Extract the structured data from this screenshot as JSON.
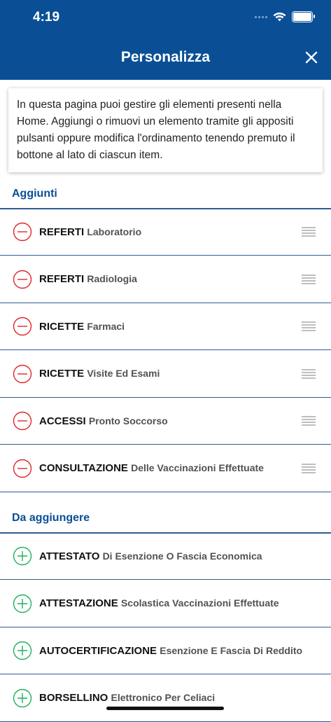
{
  "status_bar": {
    "time": "4:19"
  },
  "header": {
    "title": "Personalizza"
  },
  "info_text": "In questa pagina puoi gestire gli elementi presenti nella Home. Aggiungi o rimuovi un elemento tramite gli appositi pulsanti oppure modifica l'ordinamento tenendo premuto il bottone al lato di ciascun item.",
  "added": {
    "title": "Aggiunti",
    "items": [
      {
        "bold": "REFERTI",
        "rest": "Laboratorio"
      },
      {
        "bold": "REFERTI",
        "rest": "Radiologia"
      },
      {
        "bold": "RICETTE",
        "rest": "Farmaci"
      },
      {
        "bold": "RICETTE",
        "rest": "Visite Ed Esami"
      },
      {
        "bold": "ACCESSI",
        "rest": "Pronto Soccorso"
      },
      {
        "bold": "CONSULTAZIONE",
        "rest": "Delle Vaccinazioni Effettuate"
      }
    ]
  },
  "to_add": {
    "title": "Da aggiungere",
    "items": [
      {
        "bold": "ATTESTATO",
        "rest": "Di Esenzione O Fascia Economica"
      },
      {
        "bold": "ATTESTAZIONE",
        "rest": "Scolastica Vaccinazioni Effettuate"
      },
      {
        "bold": "AUTOCERTIFICAZIONE",
        "rest": "Esenzione E Fascia Di Reddito"
      },
      {
        "bold": "BORSELLINO",
        "rest": "Elettronico Per Celiaci"
      }
    ]
  },
  "colors": {
    "header": "#0a4f96",
    "remove": "#e0262b",
    "add": "#1fb15a",
    "divider": "#2d5d93"
  },
  "icons": {
    "remove": "minus-circle-icon",
    "add": "plus-circle-icon",
    "drag": "drag-handle-icon",
    "close": "close-icon"
  }
}
